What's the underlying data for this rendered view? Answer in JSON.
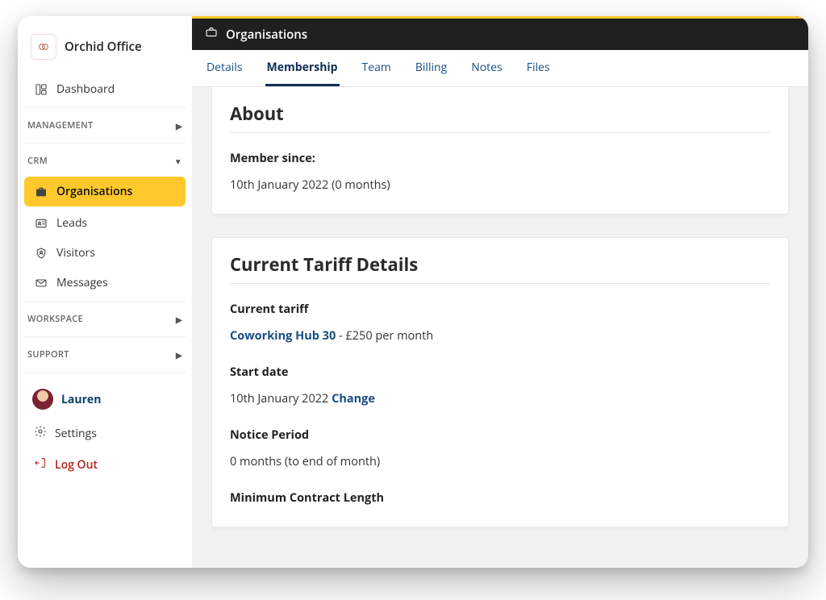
{
  "brand": {
    "name": "Orchid Office"
  },
  "sidebar": {
    "dashboard": "Dashboard",
    "sections": {
      "management": "MANAGEMENT",
      "crm": "CRM",
      "workspace": "WORKSPACE",
      "support": "SUPPORT"
    },
    "crm_items": {
      "organisations": "Organisations",
      "leads": "Leads",
      "visitors": "Visitors",
      "messages": "Messages"
    },
    "user": {
      "name": "Lauren"
    },
    "footer": {
      "settings": "Settings",
      "logout": "Log Out"
    }
  },
  "topbar": {
    "title": "Organisations"
  },
  "tabs": {
    "details": "Details",
    "membership": "Membership",
    "team": "Team",
    "billing": "Billing",
    "notes": "Notes",
    "files": "Files"
  },
  "about": {
    "heading": "About",
    "member_since_label": "Member since:",
    "member_since_value": "10th January 2022 (0 months)"
  },
  "tariff": {
    "heading": "Current Tariff Details",
    "current_label": "Current tariff",
    "current_plan": "Coworking Hub 30",
    "current_price": " - £250 per month",
    "startdate_label": "Start date",
    "startdate_value": "10th January 2022 ",
    "startdate_change": "Change",
    "notice_label": "Notice Period",
    "notice_value": "0 months (to end of month)",
    "mincontract_label": "Minimum Contract Length"
  }
}
